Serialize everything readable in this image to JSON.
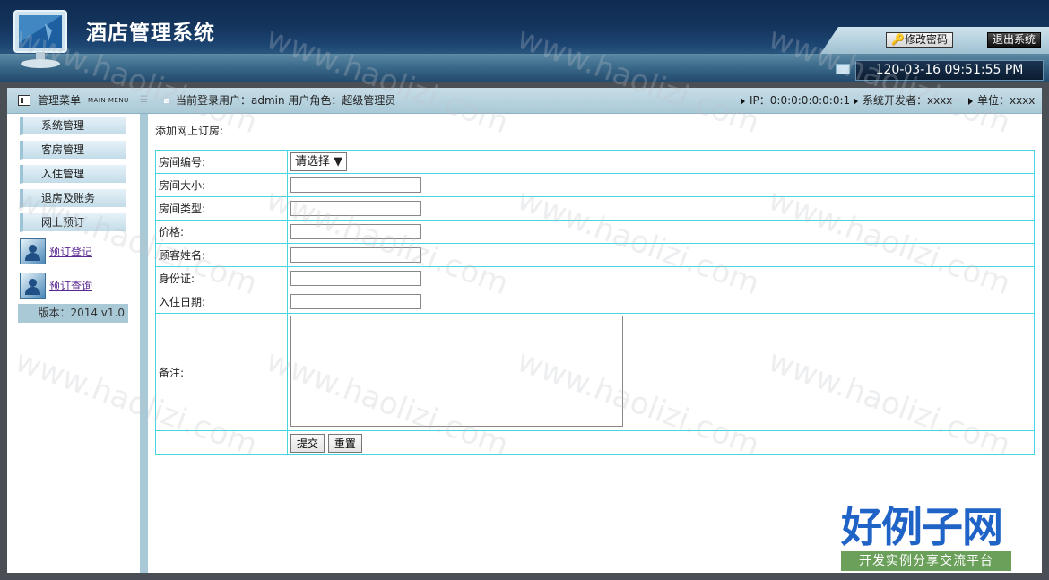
{
  "header": {
    "app_title": "酒店管理系统",
    "change_password_label": "修改密码",
    "logout_label": "退出系统",
    "clock": "120-03-16 09:51:55 PM"
  },
  "topbar": {
    "menu_title": "管理菜单",
    "menu_title_en": "MAIN MENU",
    "current_user": "当前登录用户：admin  用户角色：超级管理员",
    "ip": "IP：0:0:0:0:0:0:0:1",
    "developer": "系统开发者：xxxx",
    "unit": "单位：xxxx"
  },
  "sidebar": {
    "items": [
      "系统管理",
      "客房管理",
      "入住管理",
      "退房及账务",
      "网上预订"
    ],
    "sub_links": [
      "预订登记",
      "预订查询"
    ],
    "version": "版本：2014 v1.0"
  },
  "form": {
    "title": "添加网上订房:",
    "fields": {
      "room_no": "房间编号:",
      "room_size": "房间大小:",
      "room_type": "房间类型:",
      "price": "价格:",
      "guest_name": "顾客姓名:",
      "id_card": "身份证:",
      "checkin_date": "入住日期:",
      "remark": "备注:"
    },
    "room_no_select": "请选择",
    "submit_label": "提交",
    "reset_label": "重置"
  },
  "watermark": "www.haolizi.com",
  "brand": {
    "main": "好例子网",
    "sub": "开发实例分享交流平台"
  }
}
